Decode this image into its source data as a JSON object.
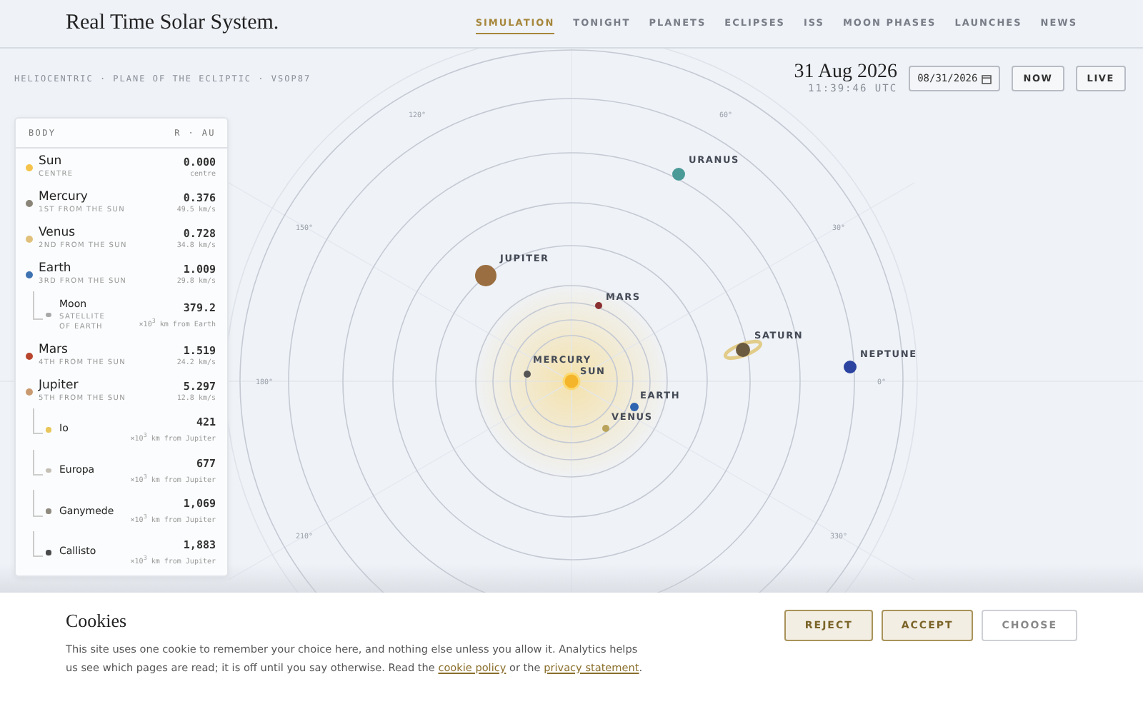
{
  "header": {
    "title": "Real Time Solar System.",
    "nav": [
      {
        "label": "SIMULATION",
        "selected": true
      },
      {
        "label": "TONIGHT",
        "selected": false
      },
      {
        "label": "PLANETS",
        "selected": false
      },
      {
        "label": "ECLIPSES",
        "selected": false
      },
      {
        "label": "ISS",
        "selected": false
      },
      {
        "label": "MOON PHASES",
        "selected": false
      },
      {
        "label": "LAUNCHES",
        "selected": false
      },
      {
        "label": "NEWS",
        "selected": false
      }
    ]
  },
  "toolbar": {
    "caption": "HELIOCENTRIC · PLANE OF THE ECLIPTIC · VSOP87",
    "date": "31 Aug 2026",
    "time": "11:39:46 UTC",
    "date_field": "08/31/2026",
    "buttons": [
      "NOW",
      "LIVE"
    ]
  },
  "sidebar": {
    "columns": [
      "BODY",
      "R · AU"
    ],
    "bodies": [
      {
        "name": "Sun",
        "sub": "CENTRE",
        "value": "0.000",
        "detail": "centre",
        "color": "#f5c34a"
      },
      {
        "name": "Mercury",
        "sub": "1ST FROM THE SUN",
        "value": "0.376",
        "detail": "49.5 km/s",
        "color": "#8a8578"
      },
      {
        "name": "Venus",
        "sub": "2ND FROM THE SUN",
        "value": "0.728",
        "detail": "34.8 km/s",
        "color": "#e0c07a"
      },
      {
        "name": "Earth",
        "sub": "3RD FROM THE SUN",
        "value": "1.009",
        "detail": "29.8 km/s",
        "color": "#3f72b0",
        "children": [
          {
            "name": "Moon",
            "sub": "SATELLITE OF EARTH",
            "value": "379.2",
            "detail": "×10$^{3}$ km from Earth",
            "color": "#a8a8a8"
          }
        ]
      },
      {
        "name": "Mars",
        "sub": "4TH FROM THE SUN",
        "value": "1.519",
        "detail": "24.2 km/s",
        "color": "#b8452e"
      },
      {
        "name": "Jupiter",
        "sub": "5TH FROM THE SUN",
        "value": "5.297",
        "detail": "12.8 km/s",
        "color": "#c99a70",
        "children": [
          {
            "name": "Io",
            "value": "421",
            "detail": "×10$^{3}$ km from Jupiter",
            "color": "#e8c65a"
          },
          {
            "name": "Europa",
            "value": "677",
            "detail": "×10$^{3}$ km from Jupiter",
            "color": "#c4bfb4"
          },
          {
            "name": "Ganymede",
            "value": "1,069",
            "detail": "×10$^{3}$ km from Jupiter",
            "color": "#8f8a80"
          },
          {
            "name": "Callisto",
            "value": "1,883",
            "detail": "×10$^{3}$ km from Jupiter",
            "color": "#4a4a4a"
          }
        ]
      }
    ]
  },
  "map": {
    "angles": [
      "120°",
      "60°",
      "150°",
      "30°",
      "180°",
      "0°",
      "210°",
      "330°"
    ],
    "planets": [
      {
        "name": "MERCURY"
      },
      {
        "name": "VENUS"
      },
      {
        "name": "EARTH"
      },
      {
        "name": "MARS"
      },
      {
        "name": "JUPITER"
      },
      {
        "name": "SATURN"
      },
      {
        "name": "URANUS"
      },
      {
        "name": "NEPTUNE"
      }
    ],
    "sun_label": "SUN"
  },
  "cookies": {
    "title": "Cookies",
    "text": "This site uses one cookie to remember your choice here, and nothing else unless you allow it. Analytics helps us see which pages are read; it is off until you say otherwise. Read the",
    "link1": "cookie policy",
    "middle": "or the",
    "link2": "privacy statement",
    "end": ".",
    "buttons": [
      {
        "label": "REJECT",
        "kind": "filled"
      },
      {
        "label": "ACCEPT",
        "kind": "filled"
      },
      {
        "label": "CHOOSE",
        "kind": "outline"
      }
    ]
  }
}
